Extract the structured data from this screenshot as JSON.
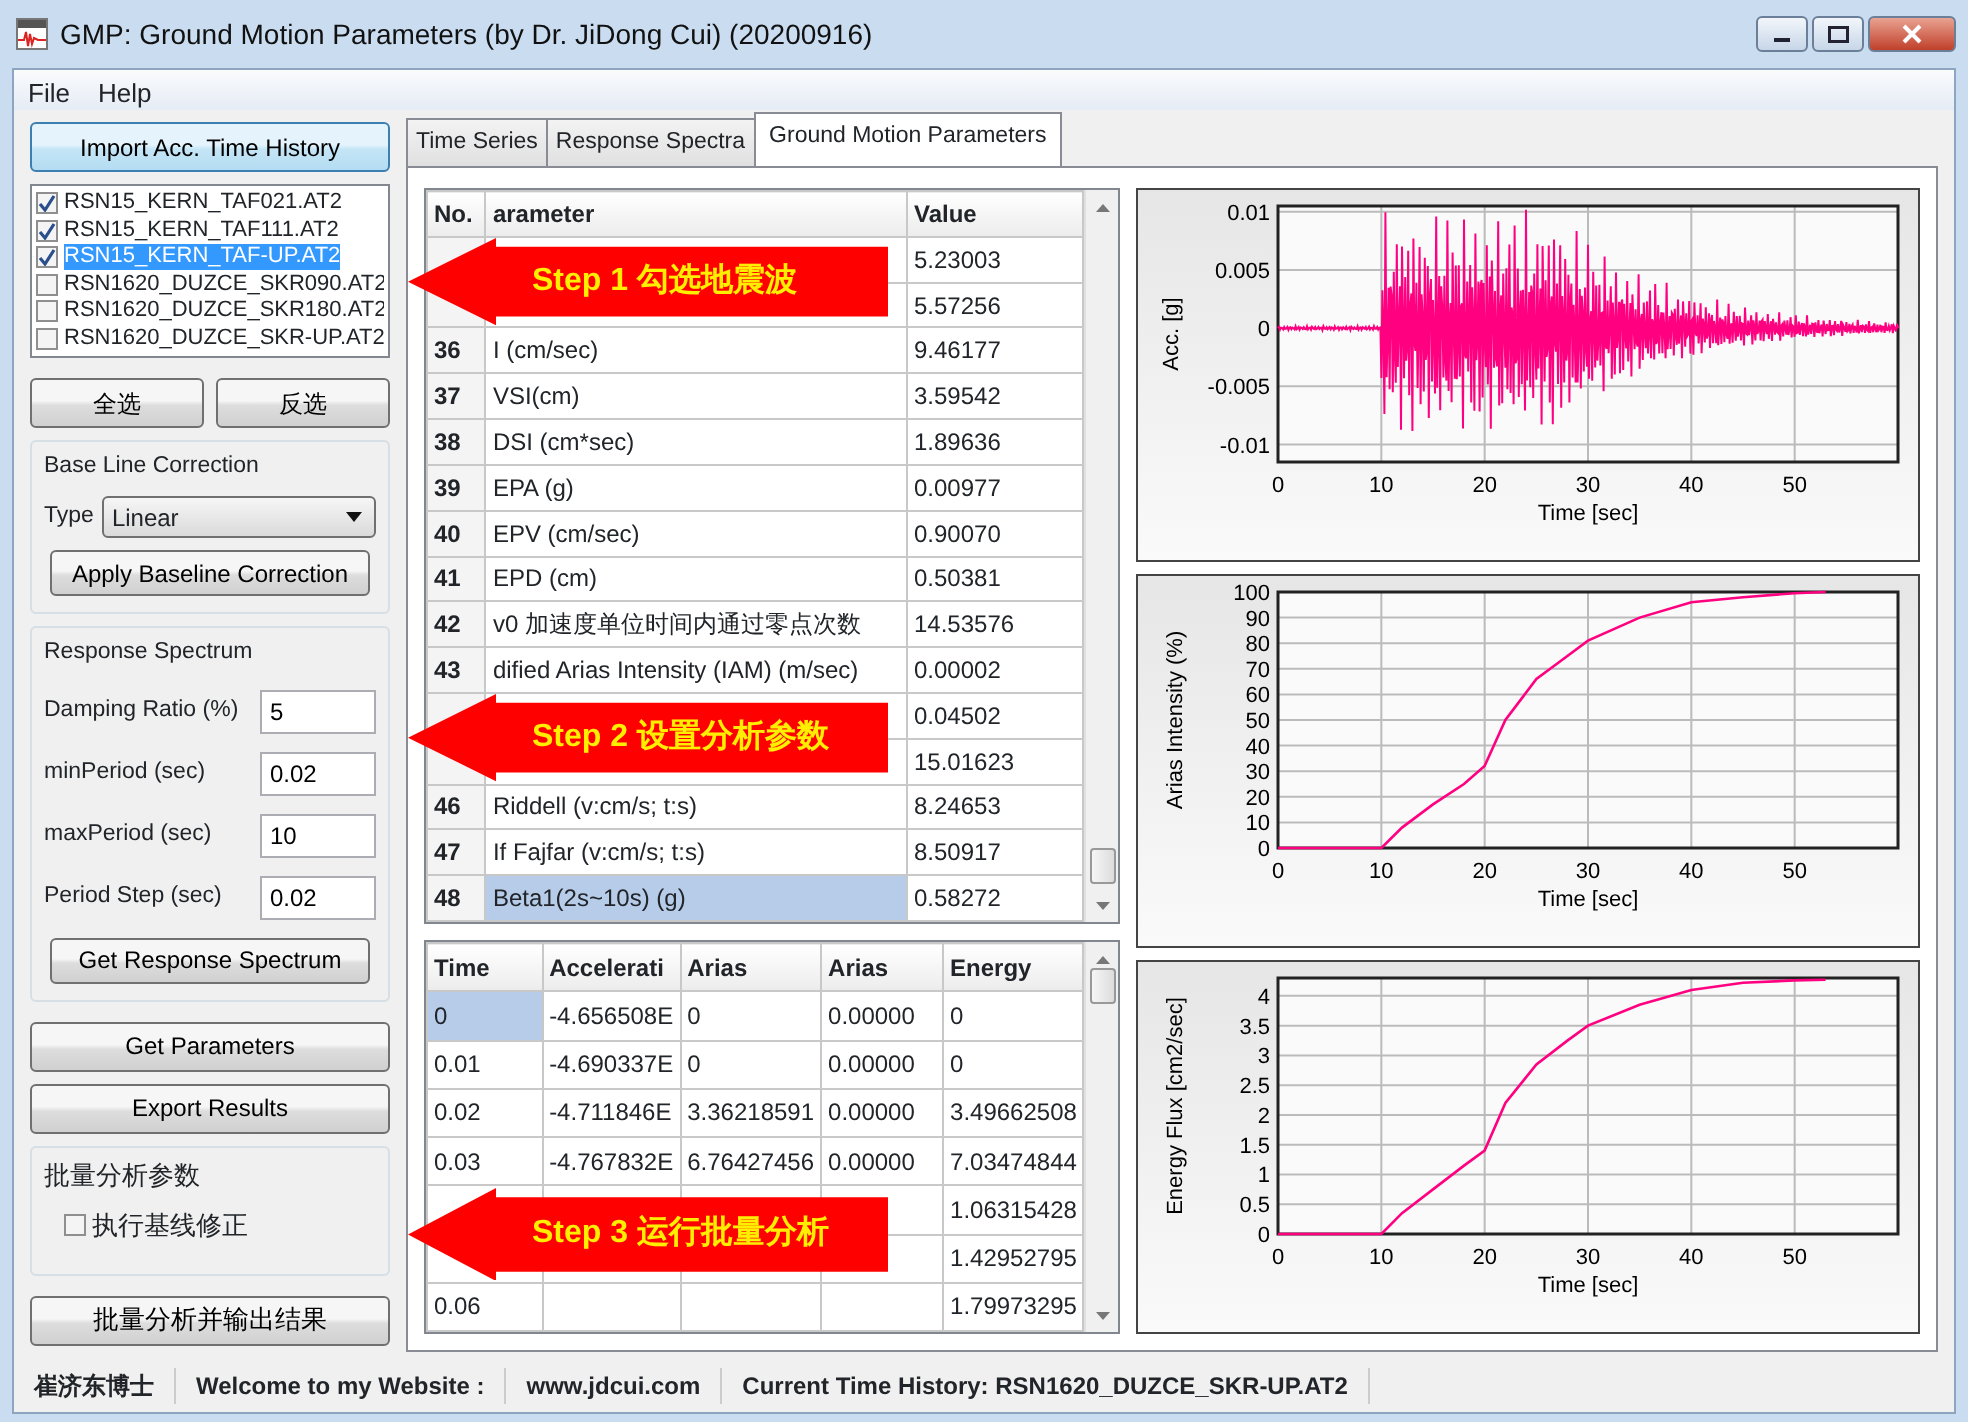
{
  "window": {
    "title": "GMP: Ground Motion Parameters (by Dr. JiDong Cui) (20200916)"
  },
  "menu": [
    "File",
    "Help"
  ],
  "left_panel": {
    "import_button": "Import Acc. Time History",
    "files": [
      {
        "label": "RSN15_KERN_TAF021.AT2",
        "checked": true,
        "selected": false
      },
      {
        "label": "RSN15_KERN_TAF111.AT2",
        "checked": true,
        "selected": false
      },
      {
        "label": "RSN15_KERN_TAF-UP.AT2",
        "checked": true,
        "selected": true
      },
      {
        "label": "RSN1620_DUZCE_SKR090.AT2",
        "checked": false,
        "selected": false
      },
      {
        "label": "RSN1620_DUZCE_SKR180.AT2",
        "checked": false,
        "selected": false
      },
      {
        "label": "RSN1620_DUZCE_SKR-UP.AT2",
        "checked": false,
        "selected": false
      }
    ],
    "select_all_button": "全选",
    "invert_button": "反选",
    "baseline": {
      "title": "Base Line Correction",
      "type_label": "Type",
      "type_value": "Linear",
      "apply_button": "Apply Baseline Correction"
    },
    "response_spectrum": {
      "title": "Response Spectrum",
      "fields": [
        {
          "label": "Damping Ratio (%)",
          "value": "5"
        },
        {
          "label": "minPeriod (sec)",
          "value": "0.02"
        },
        {
          "label": "maxPeriod (sec)",
          "value": "10"
        },
        {
          "label": "Period Step (sec)",
          "value": "0.02"
        }
      ],
      "button": "Get Response Spectrum"
    },
    "get_parameters_button": "Get Parameters",
    "export_button": "Export Results",
    "batch": {
      "title": "批量分析参数",
      "checkbox": {
        "label": "执行基线修正",
        "checked": false
      }
    },
    "batch_button": "批量分析并输出结果"
  },
  "tabs": [
    {
      "label": "Time Series",
      "selected": false
    },
    {
      "label": "Response Spectra",
      "selected": false
    },
    {
      "label": "Ground Motion Parameters",
      "selected": true
    }
  ],
  "parameter_table": {
    "columns": [
      "No.",
      "arameter",
      "Value"
    ],
    "rows": [
      {
        "no": "",
        "parameter": "",
        "value": "5.23003",
        "selected": false
      },
      {
        "no": "",
        "parameter": "",
        "value": "5.57256",
        "selected": false
      },
      {
        "no": "36",
        "parameter": "I (cm/sec)",
        "value": "9.46177",
        "selected": false
      },
      {
        "no": "37",
        "parameter": "VSI(cm)",
        "value": "3.59542",
        "selected": false
      },
      {
        "no": "38",
        "parameter": "DSI (cm*sec)",
        "value": "1.89636",
        "selected": false
      },
      {
        "no": "39",
        "parameter": "EPA (g)",
        "value": "0.00977",
        "selected": false
      },
      {
        "no": "40",
        "parameter": "EPV (cm/sec)",
        "value": "0.90070",
        "selected": false
      },
      {
        "no": "41",
        "parameter": "EPD (cm)",
        "value": "0.50381",
        "selected": false
      },
      {
        "no": "42",
        "parameter": "v0 加速度单位时间内通过零点次数",
        "value": "14.53576",
        "selected": false
      },
      {
        "no": "43",
        "parameter": "dified Arias Intensity (IAM) (m/sec)",
        "value": "0.00002",
        "selected": false
      },
      {
        "no": "",
        "parameter": "",
        "value": "0.04502",
        "selected": false
      },
      {
        "no": "",
        "parameter": "",
        "value": "15.01623",
        "selected": false
      },
      {
        "no": "46",
        "parameter": "Riddell (v:cm/s; t:s)",
        "value": "8.24653",
        "selected": false
      },
      {
        "no": "47",
        "parameter": "If Fajfar (v:cm/s; t:s)",
        "value": "8.50917",
        "selected": false
      },
      {
        "no": "48",
        "parameter": "Beta1(2s~10s) (g)",
        "value": "0.58272",
        "selected": true
      }
    ]
  },
  "series_table": {
    "columns": [
      "Time",
      "Accelerati",
      "Arias",
      "Arias",
      "Energy"
    ],
    "rows": [
      {
        "cells": [
          "0",
          "-4.656508E",
          "0",
          "0.00000",
          "0"
        ],
        "selected": true
      },
      {
        "cells": [
          "0.01",
          "-4.690337E",
          "0",
          "0.00000",
          "0"
        ],
        "selected": false
      },
      {
        "cells": [
          "0.02",
          "-4.711846E",
          "3.36218591",
          "0.00000",
          "3.49662508"
        ],
        "selected": false
      },
      {
        "cells": [
          "0.03",
          "-4.767832E",
          "6.76427456",
          "0.00000",
          "7.03474844"
        ],
        "selected": false
      },
      {
        "cells": [
          "",
          "",
          "",
          "",
          "1.06315428"
        ],
        "selected": false
      },
      {
        "cells": [
          "",
          "",
          "",
          "",
          "1.42952795"
        ],
        "selected": false
      },
      {
        "cells": [
          "0.06",
          "",
          "",
          "",
          "1.79973295"
        ],
        "selected": false
      }
    ]
  },
  "charts": [
    {
      "kind": "waveform",
      "ylabel": "Acc. [g]",
      "xlabel": "Time [sec]",
      "xticks": [
        "0",
        "10",
        "20",
        "30",
        "40",
        "50"
      ],
      "yticks": [
        "0.01",
        "0.005",
        "0",
        "-0.005",
        "-0.01"
      ]
    },
    {
      "kind": "line",
      "chart_data": {
        "type": "line",
        "xlabel": "Time [sec]",
        "ylabel": "Arias Intensity (%)",
        "x": [
          0,
          10,
          12,
          15,
          18,
          20,
          22,
          25,
          28,
          30,
          35,
          40,
          45,
          50,
          53
        ],
        "series": [
          {
            "color": "#ff0080",
            "values": [
              0,
              0,
              8,
              17,
              25,
              32,
              50,
              66,
              75,
              81,
              90,
              96,
              98,
              99.5,
              100
            ]
          }
        ],
        "grid": true,
        "xlim": [
          0,
          60
        ],
        "ylim": [
          0,
          100
        ],
        "xticks": [
          0,
          10,
          20,
          30,
          40,
          50
        ],
        "yticks": [
          0,
          10,
          20,
          30,
          40,
          50,
          60,
          70,
          80,
          90,
          100
        ]
      }
    },
    {
      "kind": "line",
      "chart_data": {
        "type": "line",
        "xlabel": "Time [sec]",
        "ylabel": "Energy Flux [cm2/sec]",
        "x": [
          0,
          10,
          12,
          15,
          18,
          20,
          22,
          25,
          28,
          30,
          35,
          40,
          45,
          50,
          53
        ],
        "series": [
          {
            "color": "#ff0080",
            "values": [
              0,
              0,
              0.35,
              0.75,
              1.15,
              1.4,
              2.2,
              2.85,
              3.25,
              3.5,
              3.85,
              4.1,
              4.22,
              4.26,
              4.27
            ]
          }
        ],
        "grid": true,
        "xlim": [
          0,
          60
        ],
        "ylim": [
          0,
          4.3
        ],
        "xticks": [
          0,
          10,
          20,
          30,
          40,
          50
        ],
        "yticks": [
          0,
          0.5,
          1,
          1.5,
          2,
          2.5,
          3,
          3.5,
          4
        ]
      }
    }
  ],
  "callouts": [
    "Step 1 勾选地震波",
    "Step 2 设置分析参数",
    "Step 3 运行批量分析"
  ],
  "status_bar": [
    "崔济东博士",
    "Welcome to my Website :",
    "www.jdcui.com",
    "Current Time History: RSN1620_DUZCE_SKR-UP.AT2"
  ]
}
